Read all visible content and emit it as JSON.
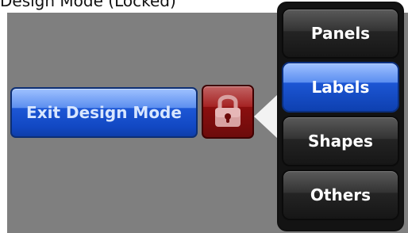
{
  "caption": "Design Mode (Locked)",
  "exit_button": {
    "label": "Exit Design Mode"
  },
  "lock_button": {
    "icon": "lock-icon",
    "state": "locked"
  },
  "side_menu": {
    "items": [
      {
        "label": "Panels",
        "active": false
      },
      {
        "label": "Labels",
        "active": true
      },
      {
        "label": "Shapes",
        "active": false
      },
      {
        "label": "Others",
        "active": false
      }
    ]
  },
  "colors": {
    "panel_background": "#7f7f7f",
    "blue_accent": "#1d57d5",
    "red_accent": "#8b0f0f",
    "menu_dark": "#161616"
  }
}
